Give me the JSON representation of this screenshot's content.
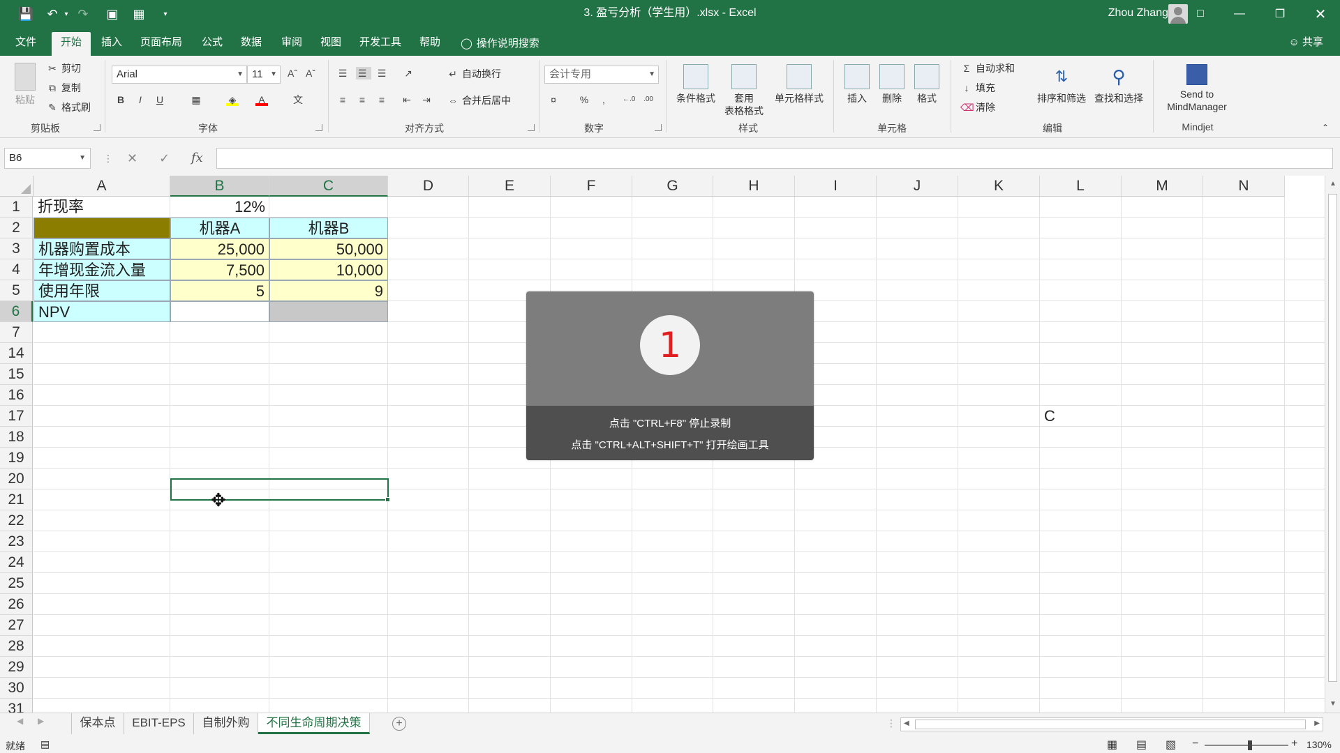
{
  "window": {
    "title": "3. 盈亏分析（学生用）.xlsx  -  Excel",
    "user": "Zhou Zhang"
  },
  "tabs": {
    "items": [
      "文件",
      "开始",
      "插入",
      "页面布局",
      "公式",
      "数据",
      "审阅",
      "视图",
      "开发工具",
      "帮助"
    ],
    "active": "开始",
    "tell_me": "操作说明搜索",
    "share": "共享"
  },
  "ribbon": {
    "clipboard": {
      "label": "剪贴板",
      "paste": "粘贴",
      "cut": "剪切",
      "copy": "复制",
      "format_painter": "格式刷"
    },
    "font": {
      "label": "字体",
      "name": "Arial",
      "size": "11",
      "bold": "B",
      "italic": "I",
      "underline": "U"
    },
    "alignment": {
      "label": "对齐方式",
      "wrap": "自动换行",
      "merge": "合并后居中"
    },
    "number": {
      "label": "数字",
      "format": "会计专用",
      "percent": "%",
      "comma": ","
    },
    "styles": {
      "label": "样式",
      "conditional": "条件格式",
      "table_line1": "套用",
      "table_line2": "表格格式",
      "cell_styles": "单元格样式"
    },
    "cells": {
      "label": "单元格",
      "insert": "插入",
      "delete": "删除",
      "format": "格式"
    },
    "editing": {
      "label": "编辑",
      "autosum": "自动求和",
      "fill": "填充",
      "clear": "清除",
      "sort": "排序和筛选",
      "find": "查找和选择"
    },
    "mindjet": {
      "label": "Mindjet",
      "send_line1": "Send to",
      "send_line2": "MindManager"
    }
  },
  "formula_bar": {
    "name_box": "B6",
    "fx": "fx",
    "value": ""
  },
  "grid": {
    "columns": [
      "A",
      "B",
      "C",
      "D",
      "E",
      "F",
      "G",
      "H",
      "I",
      "J",
      "K",
      "L",
      "M",
      "N"
    ],
    "rows": [
      "1",
      "2",
      "3",
      "4",
      "5",
      "6",
      "7",
      "14",
      "15",
      "16",
      "17",
      "18",
      "19",
      "20",
      "21",
      "22",
      "23",
      "24",
      "25",
      "26",
      "27",
      "28",
      "29",
      "30",
      "31"
    ],
    "cells": {
      "A1": "折现率",
      "B1": "12%",
      "B2": "机器A",
      "C2": "机器B",
      "A3": "机器购置成本",
      "B3": "25,000",
      "C3": "50,000",
      "A4": "年增现金流入量",
      "B4": "7,500",
      "C4": "10,000",
      "A5": "使用年限",
      "B5": "5",
      "C5": "9",
      "A6": "NPV",
      "L17": "C"
    },
    "colors": {
      "header_fill": "#8B7D00",
      "cyan_fill": "#CCFFFF",
      "yellow_fill": "#FFFFCC",
      "selection_fill": "#C8C8C8"
    }
  },
  "sheet_tabs": {
    "items": [
      "保本点",
      "EBIT-EPS",
      "自制外购",
      "不同生命周期决策"
    ],
    "active": "不同生命周期决策"
  },
  "status": {
    "ready": "就绪",
    "zoom": "130%"
  },
  "overlay": {
    "number": "1",
    "line1": "点击 \"CTRL+F8\" 停止录制",
    "line2": "点击 \"CTRL+ALT+SHIFT+T\" 打开绘画工具"
  },
  "accent": "#217346"
}
